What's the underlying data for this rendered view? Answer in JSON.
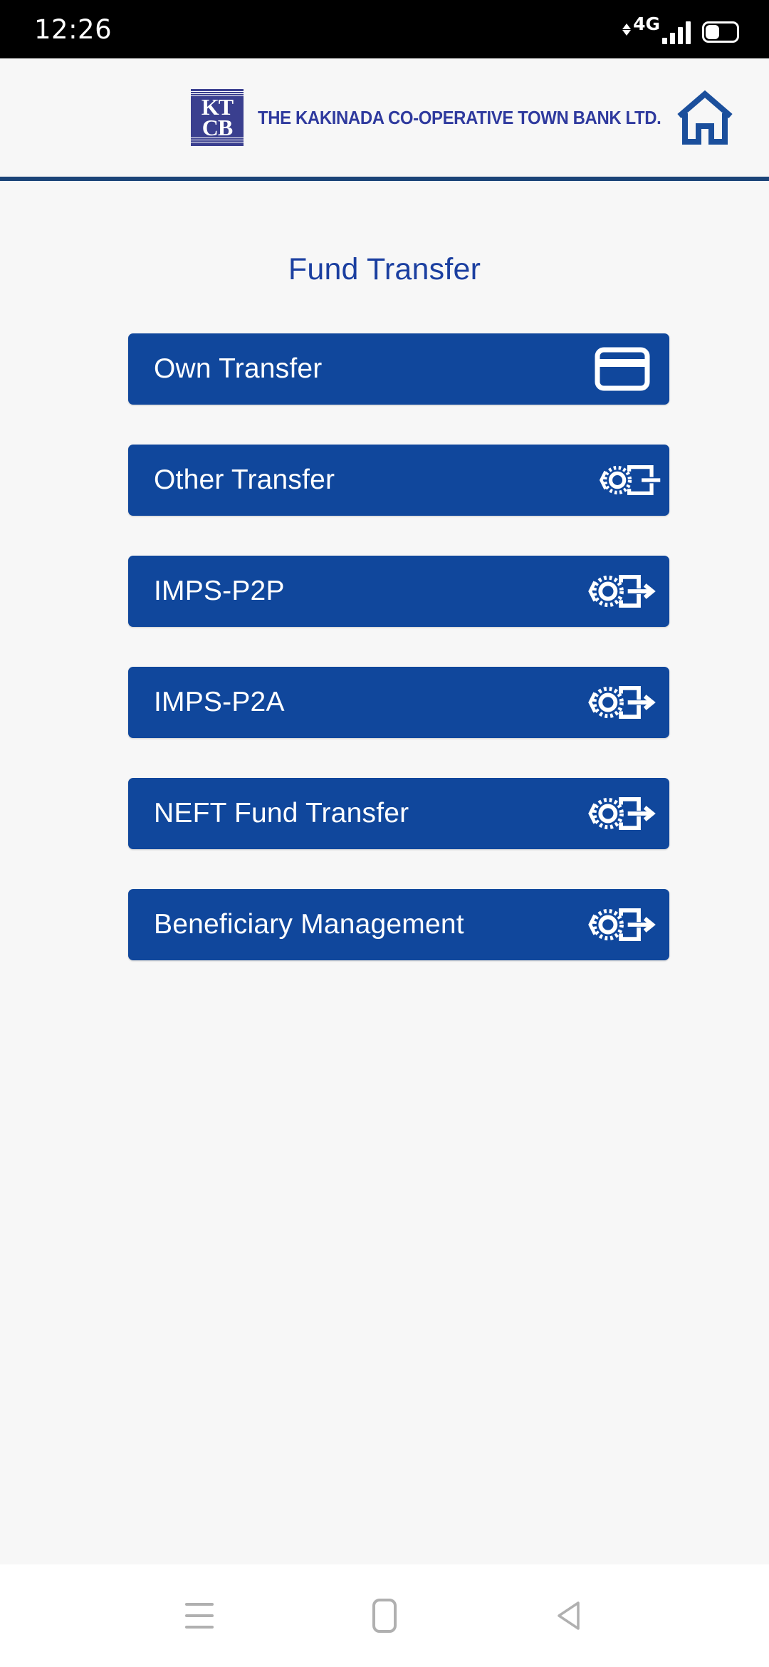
{
  "status_bar": {
    "time": "12:26",
    "network_label": "4G",
    "icons": {
      "data_arrows": "data-transfer-arrows-icon",
      "signal": "signal-bars-icon",
      "battery": "battery-icon"
    },
    "battery_level_percent": 42
  },
  "header": {
    "logo": {
      "name": "kctb-logo",
      "line1": "KT",
      "line2": "CB",
      "background_color": "#3a3f8f"
    },
    "bank_name": "THE KAKINADA CO-OPERATIVE TOWN BANK LTD.",
    "bank_name_color": "#2f3a9e",
    "home_icon": "home-icon",
    "home_icon_color": "#1b4f9c",
    "divider_color": "#1b4478"
  },
  "page": {
    "title": "Fund Transfer",
    "title_color": "#1b3fa0",
    "background_color": "#f7f7f7"
  },
  "menu": {
    "button_color": "#10479c",
    "label_color": "#ffffff",
    "items": [
      {
        "label": "Own Transfer",
        "icon": "credit-card-icon"
      },
      {
        "label": "Other Transfer",
        "icon": "fund-transfer-icon"
      },
      {
        "label": "IMPS-P2P",
        "icon": "fund-transfer-icon"
      },
      {
        "label": "IMPS-P2A",
        "icon": "fund-transfer-icon"
      },
      {
        "label": "NEFT Fund Transfer",
        "icon": "fund-transfer-icon"
      },
      {
        "label": "Beneficiary Management",
        "icon": "fund-transfer-icon"
      }
    ]
  },
  "nav_bar": {
    "background_color": "#ffffff",
    "icon_color": "#b0b0b0",
    "buttons": [
      {
        "name": "recents",
        "icon": "hamburger-icon"
      },
      {
        "name": "home",
        "icon": "home-square-icon"
      },
      {
        "name": "back",
        "icon": "back-triangle-icon"
      }
    ]
  }
}
